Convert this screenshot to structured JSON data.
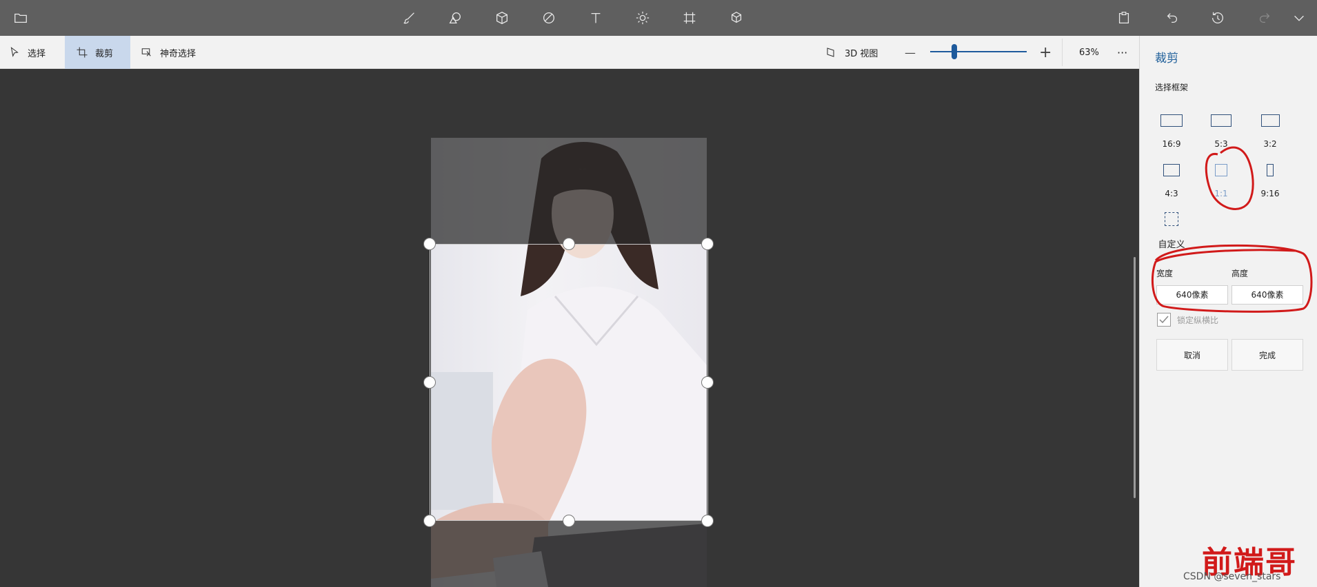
{
  "topbar": {
    "icons": [
      "folder-icon",
      "brush-icon",
      "2d-shapes-icon",
      "3d-shapes-icon",
      "stickers-icon",
      "text-icon",
      "effects-icon",
      "canvas-icon",
      "3d-library-icon",
      "paste-icon",
      "undo-icon",
      "history-icon",
      "redo-icon",
      "expand-icon"
    ]
  },
  "subbar": {
    "select_label": "选择",
    "crop_label": "裁剪",
    "magic_select_label": "神奇选择",
    "view3d_label": "3D 视图",
    "zoom_out": "—",
    "zoom_in": "+",
    "zoom_level": "63%",
    "zoom_fraction": 0.25,
    "more": "···"
  },
  "panel": {
    "title": "裁剪",
    "frame_title": "选择框架",
    "ratios": [
      {
        "label": "16:9",
        "active": false
      },
      {
        "label": "5:3",
        "active": false
      },
      {
        "label": "3:2",
        "active": false
      },
      {
        "label": "4:3",
        "active": false
      },
      {
        "label": "1:1",
        "active": true
      },
      {
        "label": "9:16",
        "active": false
      },
      {
        "label": "自定义",
        "active": false
      }
    ],
    "width_label": "宽度",
    "height_label": "高度",
    "width_value": "640像素",
    "height_value": "640像素",
    "lock_label": "锁定纵横比",
    "lock_checked": true,
    "cancel_label": "取消",
    "done_label": "完成"
  },
  "annotations": {
    "watermark": "前端哥",
    "credit": "CSDN @seven_stars",
    "highlight_color": "#d11a1a"
  }
}
